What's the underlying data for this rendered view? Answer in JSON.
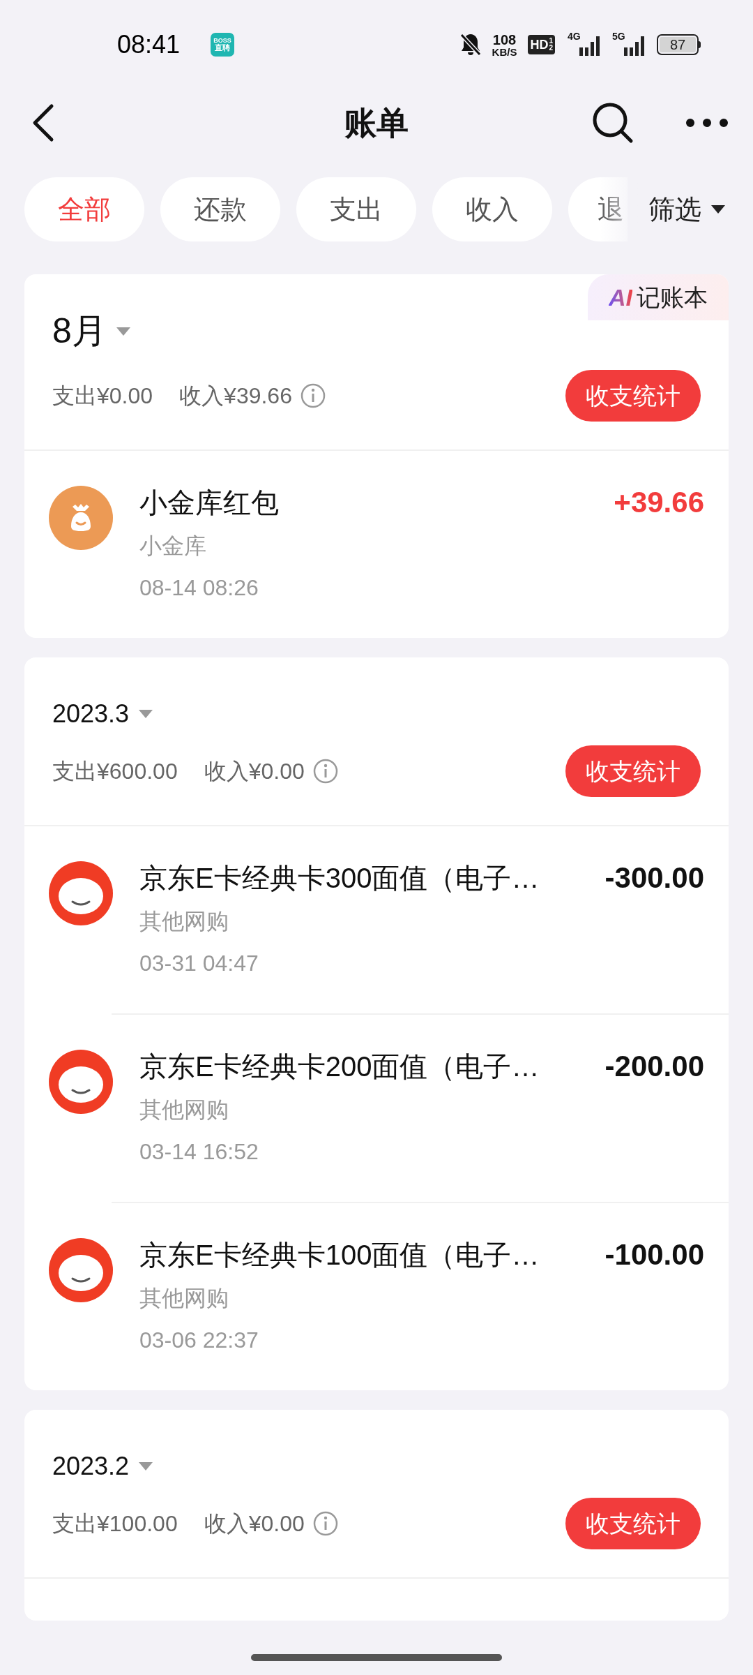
{
  "status_bar": {
    "time": "08:41",
    "app_badge": [
      "BOSS",
      "直聘"
    ],
    "speed": [
      "108",
      "KB/S"
    ],
    "hd": {
      "label": "HD",
      "sup": "1",
      "sub": "2"
    },
    "networks": [
      "4G",
      "5G"
    ],
    "battery": "87"
  },
  "header": {
    "title": "账单"
  },
  "filters": [
    {
      "label": "全部",
      "selected": true
    },
    {
      "label": "还款",
      "selected": false
    },
    {
      "label": "支出",
      "selected": false
    },
    {
      "label": "收入",
      "selected": false
    },
    {
      "label": "退",
      "selected": false
    }
  ],
  "filter_button": "筛选",
  "sections": [
    {
      "period": "8月",
      "badge": {
        "ai": "AI",
        "label": "记账本"
      },
      "expense": "支出¥0.00",
      "income": "收入¥39.66",
      "stats_button": "收支统计",
      "transactions": [
        {
          "kind": "pouch",
          "income": true,
          "title": "小金库红包",
          "category": "小金库",
          "time": "08-14 08:26",
          "amount": "+39.66"
        }
      ]
    },
    {
      "period": "2023.3",
      "expense": "支出¥600.00",
      "income": "收入¥0.00",
      "stats_button": "收支统计",
      "transactions": [
        {
          "kind": "mascot",
          "income": false,
          "title": "京东E卡经典卡300面值（电子…",
          "category": "其他网购",
          "time": "03-31 04:47",
          "amount": "-300.00"
        },
        {
          "kind": "mascot",
          "income": false,
          "title": "京东E卡经典卡200面值（电子…",
          "category": "其他网购",
          "time": "03-14 16:52",
          "amount": "-200.00"
        },
        {
          "kind": "mascot",
          "income": false,
          "title": "京东E卡经典卡100面值（电子…",
          "category": "其他网购",
          "time": "03-06 22:37",
          "amount": "-100.00"
        }
      ]
    },
    {
      "period": "2023.2",
      "expense": "支出¥100.00",
      "income": "收入¥0.00",
      "stats_button": "收支统计"
    }
  ]
}
